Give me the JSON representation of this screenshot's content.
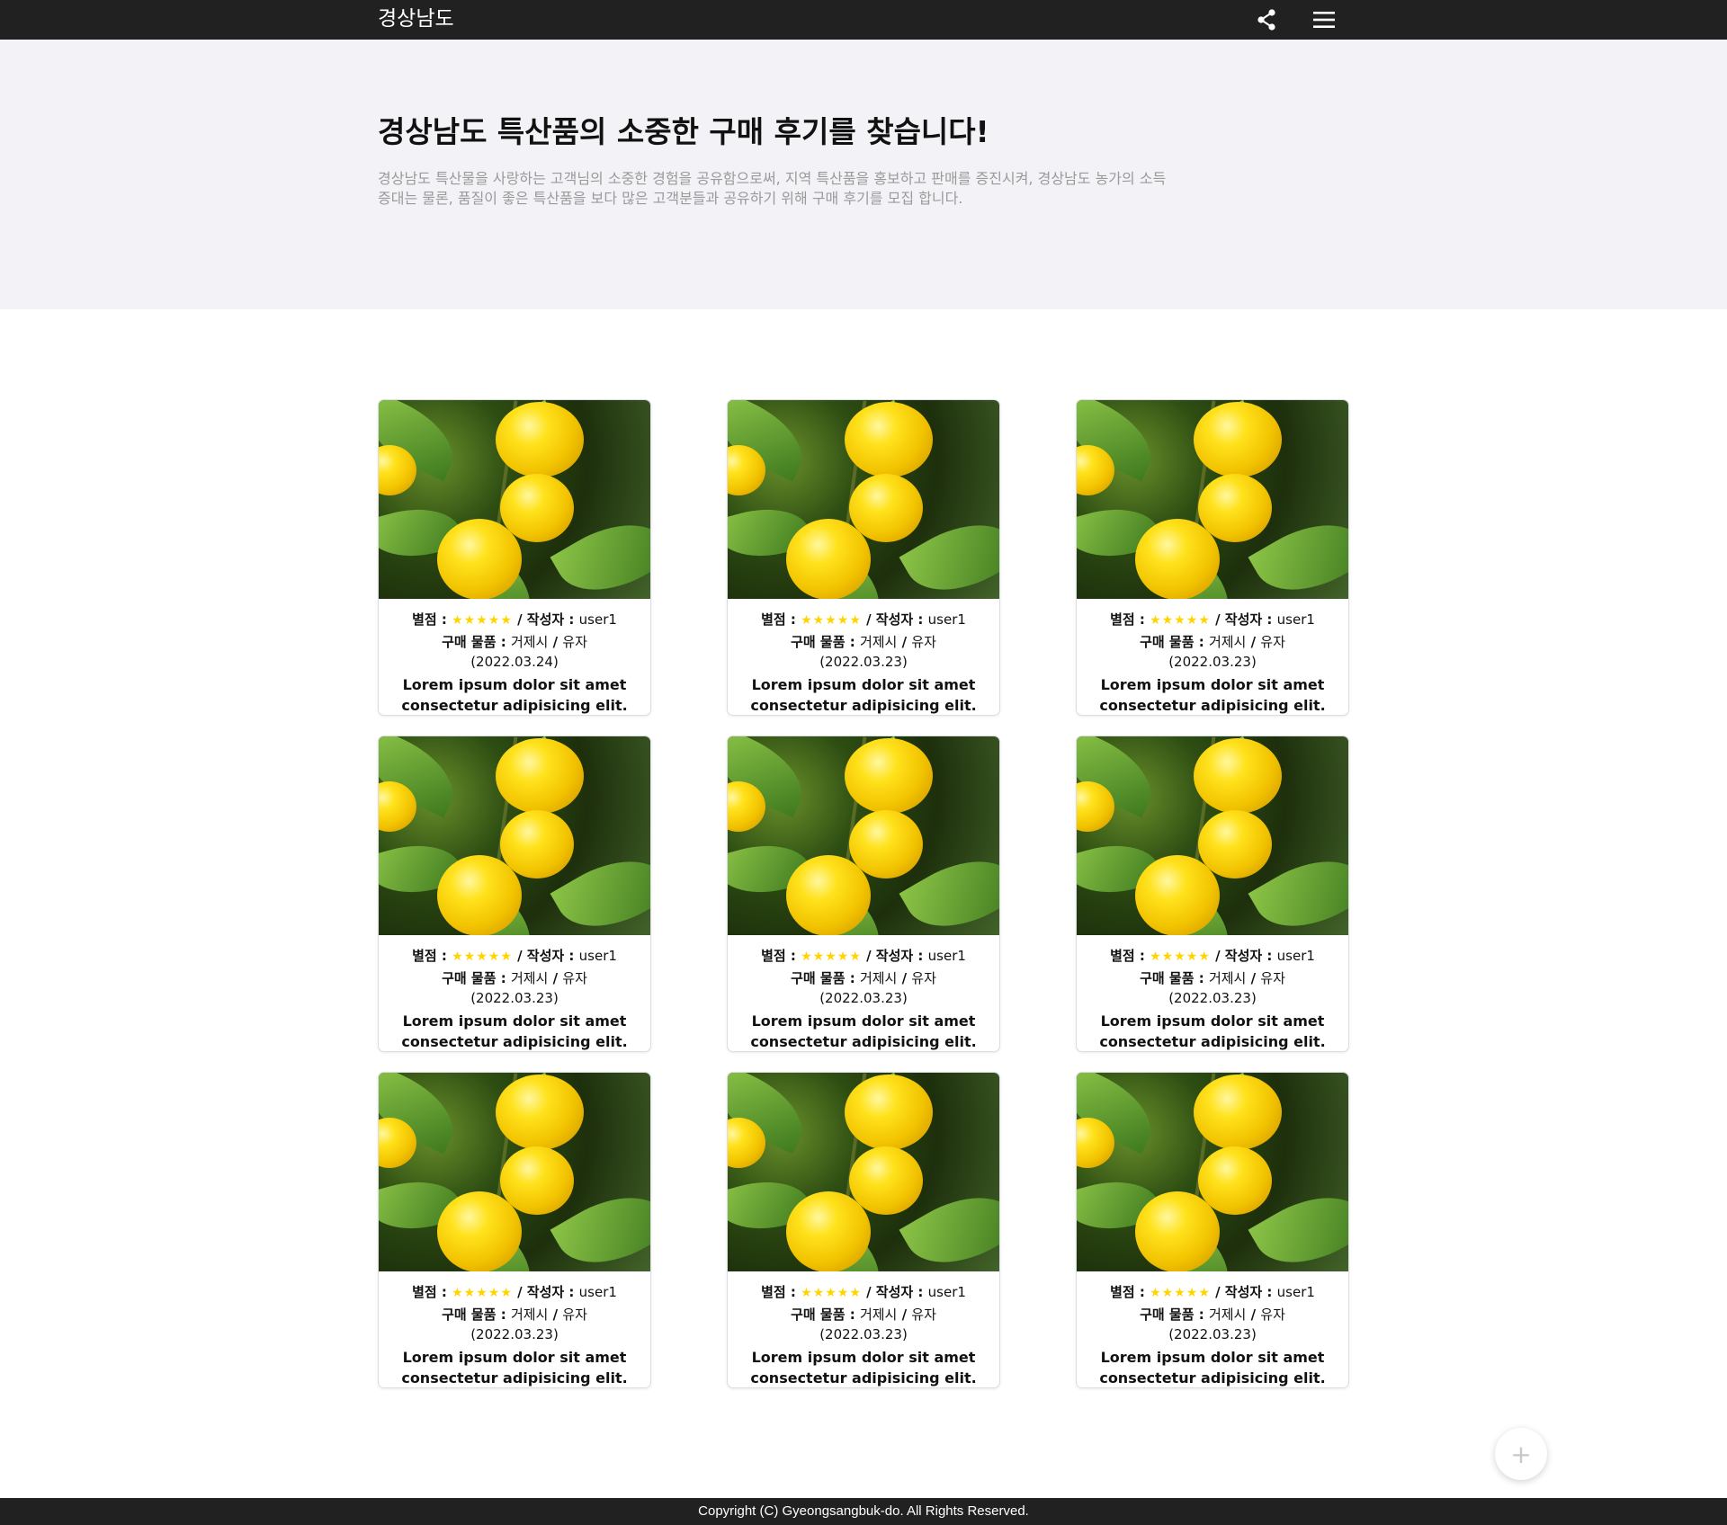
{
  "header": {
    "brand": "경상남도",
    "share_icon": "share-icon",
    "menu_icon": "menu-icon"
  },
  "hero": {
    "title": "경상남도 특산품의 소중한 구매 후기를 찾습니다!",
    "description": "경상남도 특산물을 사랑하는 고객님의 소중한 경험을 공유함으로써, 지역 특산품을 홍보하고 판매를 증진시켜, 경상남도 농가의 소득 증대는 물론, 품질이 좋은 특산품을 보다 많은 고객분들과 공유하기 위해 구매 후기를 모집 합니다."
  },
  "labels": {
    "rating": "별점 : ",
    "author": " / 작성자 : ",
    "product": "구매 물품 : ",
    "separator": " / "
  },
  "reviews": [
    {
      "stars": "★★★★★",
      "author": "user1",
      "region": "거제시",
      "item": "유자",
      "date": "(2022.03.24)",
      "summary": "Lorem ipsum dolor sit amet consectetur adipisicing elit."
    },
    {
      "stars": "★★★★★",
      "author": "user1",
      "region": "거제시",
      "item": "유자",
      "date": "(2022.03.23)",
      "summary": "Lorem ipsum dolor sit amet consectetur adipisicing elit."
    },
    {
      "stars": "★★★★★",
      "author": "user1",
      "region": "거제시",
      "item": "유자",
      "date": "(2022.03.23)",
      "summary": "Lorem ipsum dolor sit amet consectetur adipisicing elit."
    },
    {
      "stars": "★★★★★",
      "author": "user1",
      "region": "거제시",
      "item": "유자",
      "date": "(2022.03.23)",
      "summary": "Lorem ipsum dolor sit amet consectetur adipisicing elit."
    },
    {
      "stars": "★★★★★",
      "author": "user1",
      "region": "거제시",
      "item": "유자",
      "date": "(2022.03.23)",
      "summary": "Lorem ipsum dolor sit amet consectetur adipisicing elit."
    },
    {
      "stars": "★★★★★",
      "author": "user1",
      "region": "거제시",
      "item": "유자",
      "date": "(2022.03.23)",
      "summary": "Lorem ipsum dolor sit amet consectetur adipisicing elit."
    },
    {
      "stars": "★★★★★",
      "author": "user1",
      "region": "거제시",
      "item": "유자",
      "date": "(2022.03.23)",
      "summary": "Lorem ipsum dolor sit amet consectetur adipisicing elit."
    },
    {
      "stars": "★★★★★",
      "author": "user1",
      "region": "거제시",
      "item": "유자",
      "date": "(2022.03.23)",
      "summary": "Lorem ipsum dolor sit amet consectetur adipisicing elit."
    },
    {
      "stars": "★★★★★",
      "author": "user1",
      "region": "거제시",
      "item": "유자",
      "date": "(2022.03.23)",
      "summary": "Lorem ipsum dolor sit amet consectetur adipisicing elit."
    }
  ],
  "fab": {
    "label": "+",
    "icon": "plus-icon"
  },
  "footer": {
    "copyright": "Copyright (C) Gyeongsangbuk-do. All Rights Reserved."
  },
  "colors": {
    "topbar": "#212121",
    "hero_bg": "#f3f3f7",
    "star": "#ffd400"
  }
}
